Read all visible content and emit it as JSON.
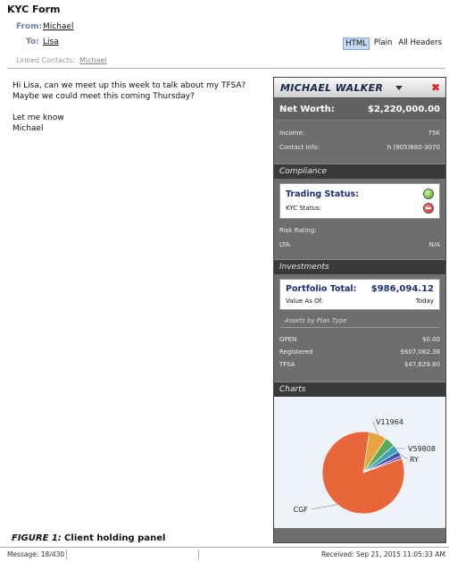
{
  "header": {
    "form_title": "KYC Form",
    "from_label": "From:",
    "from_value": "Michael",
    "to_label": "To:",
    "to_value": "Lisa",
    "linked_label": "Linked Contacts:",
    "linked_value": "Michael",
    "view_options": [
      "HTML",
      "Plain",
      "All Headers"
    ],
    "active_view": "HTML"
  },
  "message": {
    "lines": [
      "Hi Lisa, can we meet up this week to talk about my TFSA?",
      "Maybe we could meet this coming Thursday?",
      "",
      "Let me know",
      "Michael"
    ]
  },
  "panel": {
    "client_name": "MICHAEL WALKER",
    "net_worth_label": "Net Worth:",
    "net_worth_value": "$2,220,000.00",
    "income_label": "Income:",
    "income_value": "75K",
    "contact_label": "Contact Info:",
    "contact_value": "h (905)880-3070",
    "compliance_head": "Compliance",
    "trading_status_label": "Trading Status:",
    "kyc_status_label": "KYC Status:",
    "risk_label": "Risk Rating:",
    "risk_value": "",
    "lta_label": "LTA:",
    "lta_value": "N/A",
    "investments_head": "Investments",
    "portfolio_label": "Portfolio Total:",
    "portfolio_value": "$986,094.12",
    "value_as_of_label": "Value As Of:",
    "value_as_of_value": "Today",
    "assets_head": "Assets by Plan Type",
    "plans": [
      {
        "name": "OPEN",
        "value": "$0.00"
      },
      {
        "name": "Registered",
        "value": "$607,082.38"
      },
      {
        "name": "TFSA",
        "value": "$47,629.60"
      }
    ],
    "charts_head": "Charts",
    "colors": {
      "trading_ok": "#49a91f",
      "kyc_bad": "#d41d1d",
      "title": "#1b2f7a"
    }
  },
  "chart_data": {
    "type": "pie",
    "title": "",
    "slices": [
      {
        "label": "CGF",
        "value": 83,
        "color": "#e8663a"
      },
      {
        "label": "V11964",
        "value": 7,
        "color": "#e9a33c"
      },
      {
        "label": "",
        "value": 4,
        "color": "#5aa85a"
      },
      {
        "label": "V59808",
        "value": 3,
        "color": "#3fa3b6"
      },
      {
        "label": "RY",
        "value": 2,
        "color": "#3a55a8"
      },
      {
        "label": "",
        "value": 1,
        "color": "#8a3ab6"
      }
    ]
  },
  "caption": {
    "figure_label": "FIGURE 1:",
    "figure_text": "Client holding panel"
  },
  "status_bar": {
    "message_count": "Message: 18/430",
    "received": "Received: Sep 21, 2015 11:05:33 AM"
  }
}
